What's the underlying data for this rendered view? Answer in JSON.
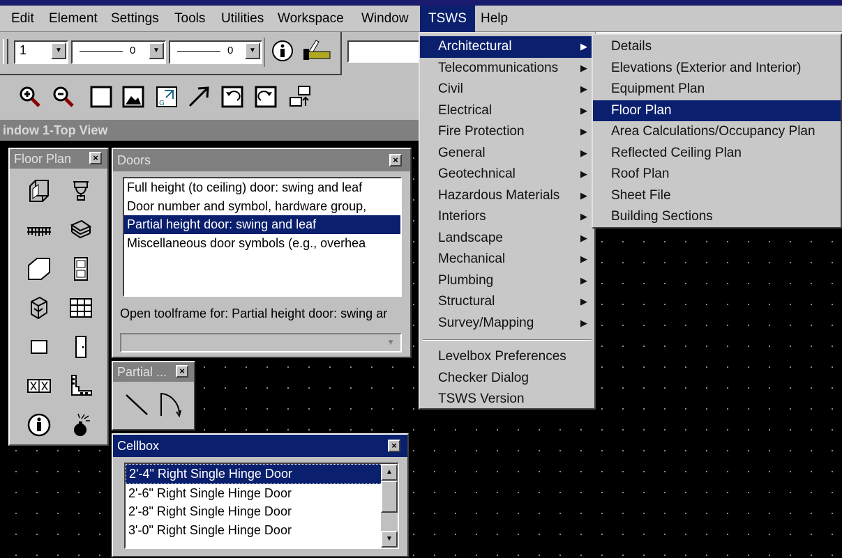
{
  "menubar": {
    "items": [
      {
        "label": "Edit"
      },
      {
        "label": "Element"
      },
      {
        "label": "Settings"
      },
      {
        "label": "Tools"
      },
      {
        "label": "Utilities"
      },
      {
        "label": "Workspace"
      },
      {
        "label": "Window"
      },
      {
        "label": "TSWS"
      },
      {
        "label": "Help"
      }
    ]
  },
  "toolbar": {
    "level_value": "1",
    "line_style_value": "0",
    "line_weight_value": "0"
  },
  "view": {
    "title": "indow 1-Top View"
  },
  "tsws_menu": {
    "items": [
      {
        "label": "Architectural"
      },
      {
        "label": "Telecommunications"
      },
      {
        "label": "Civil"
      },
      {
        "label": "Electrical"
      },
      {
        "label": "Fire Protection"
      },
      {
        "label": "General"
      },
      {
        "label": "Geotechnical"
      },
      {
        "label": "Hazardous Materials"
      },
      {
        "label": "Interiors"
      },
      {
        "label": "Landscape"
      },
      {
        "label": "Mechanical"
      },
      {
        "label": "Plumbing"
      },
      {
        "label": "Structural"
      },
      {
        "label": "Survey/Mapping"
      }
    ],
    "extra_items": [
      {
        "label": "Levelbox Preferences"
      },
      {
        "label": "Checker Dialog"
      },
      {
        "label": "TSWS Version"
      }
    ]
  },
  "architectural_submenu": {
    "items": [
      {
        "label": "Details"
      },
      {
        "label": "Elevations (Exterior and Interior)"
      },
      {
        "label": "Equipment Plan"
      },
      {
        "label": "Floor Plan"
      },
      {
        "label": "Area Calculations/Occupancy Plan"
      },
      {
        "label": "Reflected Ceiling Plan"
      },
      {
        "label": "Roof Plan"
      },
      {
        "label": "Sheet File"
      },
      {
        "label": "Building Sections"
      }
    ]
  },
  "floorplan_palette": {
    "title": "Floor Plan"
  },
  "doors_palette": {
    "title": "Doors",
    "items": [
      {
        "label": "Full height (to ceiling) door: swing and leaf"
      },
      {
        "label": "Door number and symbol, hardware group,"
      },
      {
        "label": "Partial height door: swing and leaf"
      },
      {
        "label": "Miscellaneous door symbols (e.g., overhea"
      }
    ],
    "toolframe_text": "Open toolframe for: Partial height door: swing ar"
  },
  "partial_palette": {
    "title": "Partial ..."
  },
  "cellbox": {
    "title": "Cellbox",
    "items": [
      {
        "label": "2'-4\" Right Single Hinge Door"
      },
      {
        "label": "2'-6\" Right Single Hinge Door"
      },
      {
        "label": "2'-8\" Right Single Hinge Door"
      },
      {
        "label": "3'-0\" Right Single Hinge Door"
      }
    ]
  }
}
